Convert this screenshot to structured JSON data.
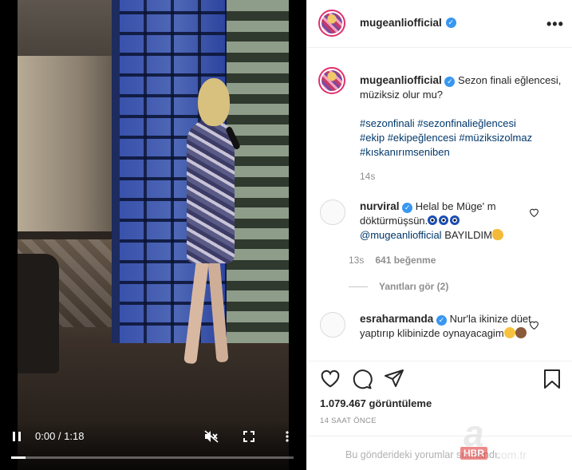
{
  "video": {
    "time": "0:00 / 1:18",
    "progress_fraction": 0.05
  },
  "post": {
    "username": "mugeanliofficial",
    "more_icon": "more-horizontal-icon"
  },
  "caption": {
    "username": "mugeanliofficial",
    "text": "Sezon finali eğlencesi, müziksiz olur mu?",
    "hashtags": [
      "#sezonfinali",
      "#sezonfinalieğlencesi",
      "#ekip",
      "#ekipeğlencesi",
      "#müziksizolmaz",
      "#kıskanırımseniben"
    ],
    "time": "14s"
  },
  "comments": [
    {
      "username": "nurviral",
      "text_1": "Helal be Müge' m döktürmüşsün.",
      "mention": "@mugeanliofficial",
      "text_2": "BAYILDIM",
      "time": "13s",
      "likes": "641 beğenme"
    },
    {
      "username": "esraharmanda",
      "text": "Nur'la ikinize düet yaptırıp klibinizde oynayacagim"
    }
  ],
  "replies_label": "Yanıtları gör (2)",
  "stats": {
    "views": "1.079.467 görüntüleme",
    "date": "14 SAAT ÖNCE"
  },
  "footer": {
    "comments_off": "Bu gönderideki yorumlar sınırlandı."
  },
  "watermark": {
    "letter": "a",
    "badge": "HBR",
    "domain": "com.tr"
  },
  "colors": {
    "verified": "#3897f0",
    "link": "#00376b",
    "muted": "#8e8e8e"
  }
}
